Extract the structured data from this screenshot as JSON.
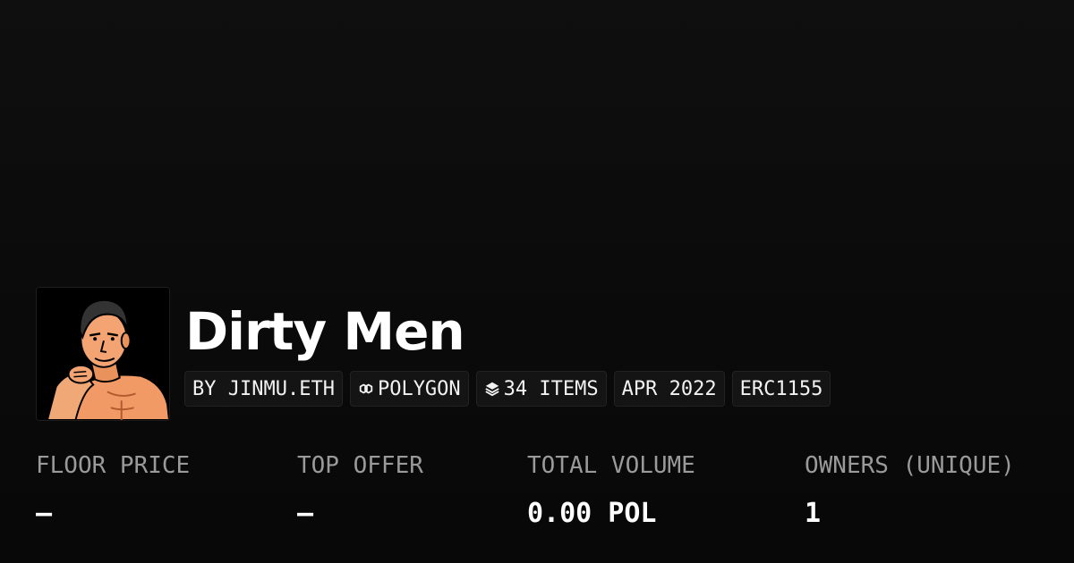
{
  "collection": {
    "name": "Dirty Men",
    "avatar_icon": "cartoon-man-avatar"
  },
  "chips": {
    "creator": "BY JINMU.ETH",
    "chain": "POLYGON",
    "items": "34 ITEMS",
    "date": "APR 2022",
    "standard": "ERC1155"
  },
  "stats": {
    "floor_price": {
      "label": "FLOOR PRICE",
      "value": "–"
    },
    "top_offer": {
      "label": "TOP OFFER",
      "value": "–"
    },
    "total_volume": {
      "label": "TOTAL VOLUME",
      "value": "0.00 POL"
    },
    "owners": {
      "label": "OWNERS (UNIQUE)",
      "value": "1"
    }
  },
  "colors": {
    "background": "#0b0b0b",
    "text": "#ffffff",
    "muted": "#9a9a9a",
    "chip_bg": "#141414"
  }
}
